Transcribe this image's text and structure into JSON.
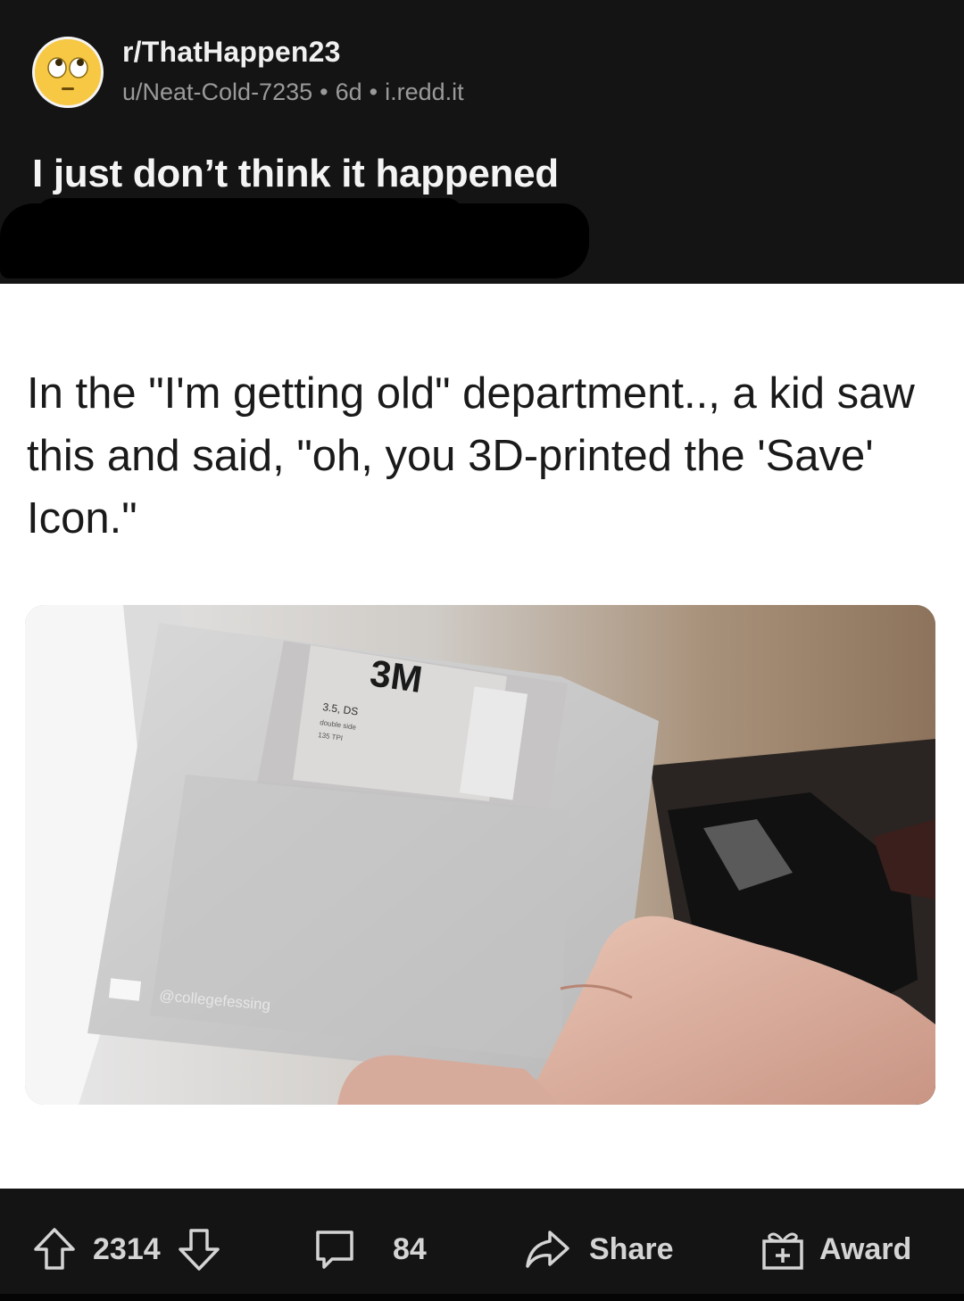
{
  "post": {
    "subreddit": "r/ThatHappen23",
    "author": "u/Neat-Cold-7235",
    "age": "6d",
    "domain": "i.redd.it",
    "separator": "•",
    "title": "I just don’t think it happened"
  },
  "image": {
    "caption": "In the \"I'm getting old\" department.., a kid saw this and said, \"oh, you 3D-printed the 'Save' Icon.\"",
    "disk_brand": "3M",
    "disk_label_line1": "3.5, DS",
    "disk_label_line2": "double side",
    "disk_label_line3": "135 TPI",
    "watermark": "@collegefessing"
  },
  "actions": {
    "upvotes": "2314",
    "comments": "84",
    "share_label": "Share",
    "award_label": "Award"
  },
  "icons": {
    "avatar": "rolling-eyes-face-icon",
    "upvote": "arrow-up-icon",
    "downvote": "arrow-down-icon",
    "comment": "speech-bubble-icon",
    "share": "share-arrow-icon",
    "award": "gift-icon"
  },
  "colors": {
    "header_bg": "#141414",
    "content_bg": "#ffffff",
    "avatar": "#f5c43e"
  }
}
